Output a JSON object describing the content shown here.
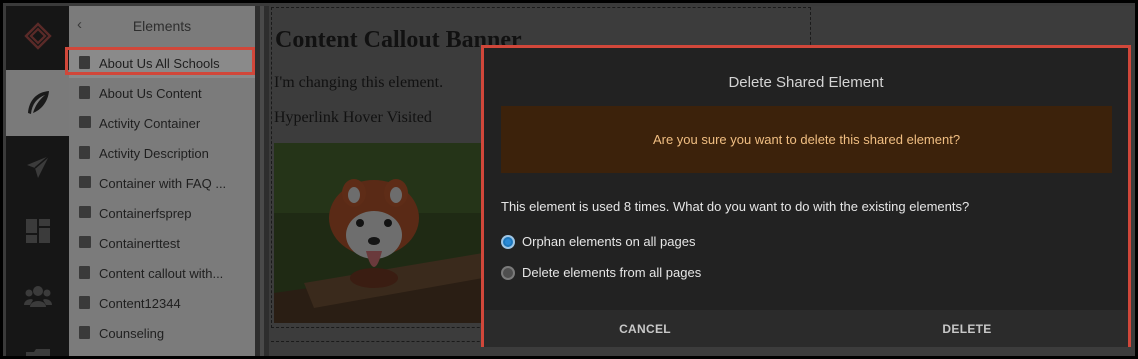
{
  "panel": {
    "title": "Elements",
    "back_glyph": "‹",
    "items": [
      {
        "label": "About Us All Schools",
        "icon": "document-icon"
      },
      {
        "label": "About Us Content",
        "icon": "document-icon"
      },
      {
        "label": "Activity Container",
        "icon": "container-icon"
      },
      {
        "label": "Activity Description",
        "icon": "document-icon"
      },
      {
        "label": "Container with FAQ ...",
        "icon": "container-icon"
      },
      {
        "label": "Containerfsprep",
        "icon": "container-icon"
      },
      {
        "label": "Containerttest",
        "icon": "container-icon"
      },
      {
        "label": "Content callout with...",
        "icon": "document-icon"
      },
      {
        "label": "Content12344",
        "icon": "document-icon"
      },
      {
        "label": "Counseling",
        "icon": "document-icon"
      }
    ]
  },
  "rail": {
    "icons": [
      "logo-icon",
      "feather-icon",
      "paper-plane-icon",
      "layout-icon",
      "users-icon",
      "folder-icon"
    ]
  },
  "content": {
    "title": "Content Callout Banner",
    "text": "I'm changing this element.",
    "links": "Hyperlink Hover Visited"
  },
  "modal": {
    "title": "Delete Shared Element",
    "warning": "Are you sure you want to delete this shared element?",
    "question": "This element is used 8 times. What do you want to do with the existing elements?",
    "options": [
      {
        "label": "Orphan elements on all pages",
        "selected": true
      },
      {
        "label": "Delete elements from all pages",
        "selected": false
      }
    ],
    "cancel_label": "CANCEL",
    "delete_label": "DELETE"
  },
  "colors": {
    "highlight_outline": "#d1473a",
    "warning_bg": "#3c220b",
    "warning_text": "#f0be82",
    "radio_selected": "#1e78bd"
  }
}
